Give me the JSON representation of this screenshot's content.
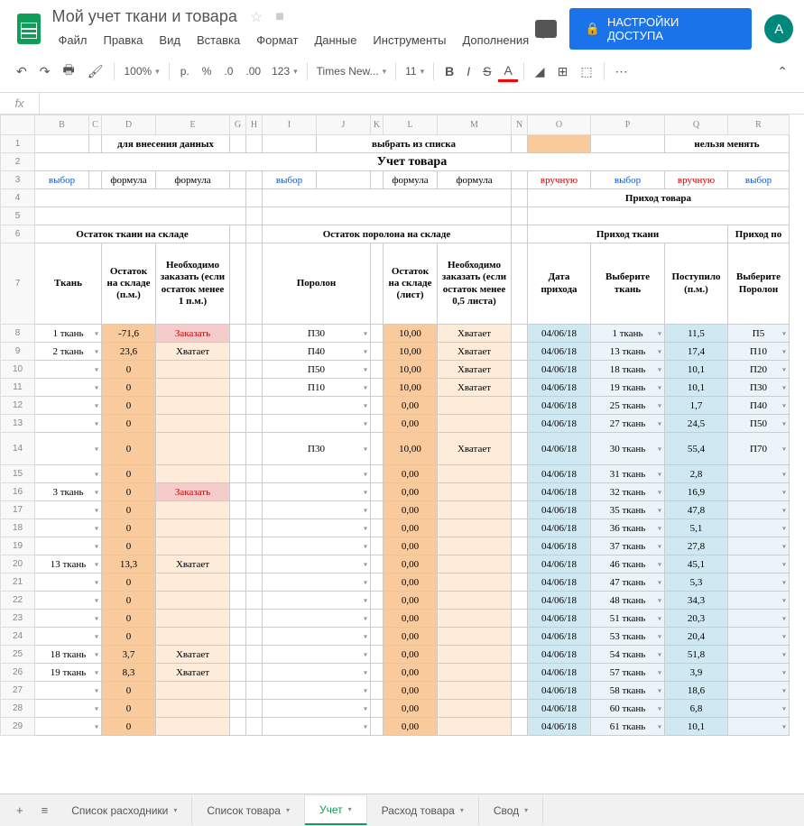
{
  "doc": {
    "title": "Мой учет ткани и товара",
    "avatar": "A"
  },
  "menus": [
    "Файл",
    "Правка",
    "Вид",
    "Вставка",
    "Формат",
    "Данные",
    "Инструменты",
    "Дополнения"
  ],
  "share": "НАСТРОЙКИ ДОСТУПА",
  "toolbar": {
    "zoom": "100%",
    "cur": "р.",
    "pct": "%",
    "dec0": ".0",
    "dec00": ".00",
    "num": "123",
    "font": "Times New...",
    "size": "11"
  },
  "fx": "fx",
  "cols": [
    "",
    "B",
    "C",
    "D",
    "E",
    "G",
    "H",
    "I",
    "J",
    "K",
    "L",
    "M",
    "N",
    "O",
    "P",
    "Q",
    "R"
  ],
  "widths": [
    38,
    60,
    14,
    60,
    82,
    18,
    18,
    60,
    60,
    14,
    60,
    82,
    18,
    70,
    82,
    70,
    68
  ],
  "legend": {
    "a": "для внесения данных",
    "b": "выбрать из списка",
    "c": "нельзя менять"
  },
  "title": "Учет товара",
  "hdr3": {
    "sel": "выбор",
    "form": "формула",
    "man": "вручную"
  },
  "hdr4": {
    "prihod": "Приход товара"
  },
  "hdr6": {
    "a": "Остаток ткани на складе",
    "b": "Остаток поролона на складе",
    "c": "Приход ткани",
    "d": "Приход по"
  },
  "hdr7": {
    "tkan": "Ткань",
    "ost_pm": "Остаток на складе (п.м.)",
    "ord_pm": "Необходимо заказать (если остаток менее 1 п.м.)",
    "por": "Поролон",
    "ost_l": "Остаток на складе (лист)",
    "ord_l": "Необходимо заказать (если остаток менее 0,5 листа)",
    "date": "Дата прихода",
    "seltk": "Выберите ткань",
    "post": "Поступило (п.м.)",
    "selpor": "Выберите Поролон"
  },
  "rows": [
    {
      "n": "8",
      "tk": "1 ткань",
      "ost": "-71,6",
      "ord": "Заказать",
      "por": "П30",
      "pol": "10,00",
      "pord": "Хватает",
      "dt": "04/06/18",
      "st": "1 ткань",
      "pm": "11,5",
      "sp": "П5"
    },
    {
      "n": "9",
      "tk": "2 ткань",
      "ost": "23,6",
      "ord": "Хватает",
      "por": "П40",
      "pol": "10,00",
      "pord": "Хватает",
      "dt": "04/06/18",
      "st": "13 ткань",
      "pm": "17,4",
      "sp": "П10"
    },
    {
      "n": "10",
      "tk": "",
      "ost": "0",
      "ord": "",
      "por": "П50",
      "pol": "10,00",
      "pord": "Хватает",
      "dt": "04/06/18",
      "st": "18 ткань",
      "pm": "10,1",
      "sp": "П20"
    },
    {
      "n": "11",
      "tk": "",
      "ost": "0",
      "ord": "",
      "por": "П10",
      "pol": "10,00",
      "pord": "Хватает",
      "dt": "04/06/18",
      "st": "19 ткань",
      "pm": "10,1",
      "sp": "П30"
    },
    {
      "n": "12",
      "tk": "",
      "ost": "0",
      "ord": "",
      "por": "",
      "pol": "0,00",
      "pord": "",
      "dt": "04/06/18",
      "st": "25 ткань",
      "pm": "1,7",
      "sp": "П40"
    },
    {
      "n": "13",
      "tk": "",
      "ost": "0",
      "ord": "",
      "por": "",
      "pol": "0,00",
      "pord": "",
      "dt": "04/06/18",
      "st": "27 ткань",
      "pm": "24,5",
      "sp": "П50"
    },
    {
      "n": "14",
      "tk": "",
      "ost": "0",
      "ord": "",
      "por": "П30",
      "pol": "10,00",
      "pord": "Хватает",
      "dt": "04/06/18",
      "st": "30 ткань",
      "pm": "55,4",
      "sp": "П70",
      "tall": true
    },
    {
      "n": "15",
      "tk": "",
      "ost": "0",
      "ord": "",
      "por": "",
      "pol": "0,00",
      "pord": "",
      "dt": "04/06/18",
      "st": "31 ткань",
      "pm": "2,8",
      "sp": ""
    },
    {
      "n": "16",
      "tk": "3 ткань",
      "ost": "0",
      "ord": "Заказать",
      "por": "",
      "pol": "0,00",
      "pord": "",
      "dt": "04/06/18",
      "st": "32 ткань",
      "pm": "16,9",
      "sp": ""
    },
    {
      "n": "17",
      "tk": "",
      "ost": "0",
      "ord": "",
      "por": "",
      "pol": "0,00",
      "pord": "",
      "dt": "04/06/18",
      "st": "35 ткань",
      "pm": "47,8",
      "sp": ""
    },
    {
      "n": "18",
      "tk": "",
      "ost": "0",
      "ord": "",
      "por": "",
      "pol": "0,00",
      "pord": "",
      "dt": "04/06/18",
      "st": "36 ткань",
      "pm": "5,1",
      "sp": ""
    },
    {
      "n": "19",
      "tk": "",
      "ost": "0",
      "ord": "",
      "por": "",
      "pol": "0,00",
      "pord": "",
      "dt": "04/06/18",
      "st": "37 ткань",
      "pm": "27,8",
      "sp": ""
    },
    {
      "n": "20",
      "tk": "13 ткань",
      "ost": "13,3",
      "ord": "Хватает",
      "por": "",
      "pol": "0,00",
      "pord": "",
      "dt": "04/06/18",
      "st": "46 ткань",
      "pm": "45,1",
      "sp": ""
    },
    {
      "n": "21",
      "tk": "",
      "ost": "0",
      "ord": "",
      "por": "",
      "pol": "0,00",
      "pord": "",
      "dt": "04/06/18",
      "st": "47 ткань",
      "pm": "5,3",
      "sp": ""
    },
    {
      "n": "22",
      "tk": "",
      "ost": "0",
      "ord": "",
      "por": "",
      "pol": "0,00",
      "pord": "",
      "dt": "04/06/18",
      "st": "48 ткань",
      "pm": "34,3",
      "sp": ""
    },
    {
      "n": "23",
      "tk": "",
      "ost": "0",
      "ord": "",
      "por": "",
      "pol": "0,00",
      "pord": "",
      "dt": "04/06/18",
      "st": "51 ткань",
      "pm": "20,3",
      "sp": ""
    },
    {
      "n": "24",
      "tk": "",
      "ost": "0",
      "ord": "",
      "por": "",
      "pol": "0,00",
      "pord": "",
      "dt": "04/06/18",
      "st": "53 ткань",
      "pm": "20,4",
      "sp": ""
    },
    {
      "n": "25",
      "tk": "18 ткань",
      "ost": "3,7",
      "ord": "Хватает",
      "por": "",
      "pol": "0,00",
      "pord": "",
      "dt": "04/06/18",
      "st": "54 ткань",
      "pm": "51,8",
      "sp": ""
    },
    {
      "n": "26",
      "tk": "19 ткань",
      "ost": "8,3",
      "ord": "Хватает",
      "por": "",
      "pol": "0,00",
      "pord": "",
      "dt": "04/06/18",
      "st": "57 ткань",
      "pm": "3,9",
      "sp": ""
    },
    {
      "n": "27",
      "tk": "",
      "ost": "0",
      "ord": "",
      "por": "",
      "pol": "0,00",
      "pord": "",
      "dt": "04/06/18",
      "st": "58 ткань",
      "pm": "18,6",
      "sp": ""
    },
    {
      "n": "28",
      "tk": "",
      "ost": "0",
      "ord": "",
      "por": "",
      "pol": "0,00",
      "pord": "",
      "dt": "04/06/18",
      "st": "60 ткань",
      "pm": "6,8",
      "sp": ""
    },
    {
      "n": "29",
      "tk": "",
      "ost": "0",
      "ord": "",
      "por": "",
      "pol": "0,00",
      "pord": "",
      "dt": "04/06/18",
      "st": "61 ткань",
      "pm": "10,1",
      "sp": ""
    }
  ],
  "tabs": [
    "Список расходники",
    "Список товара",
    "Учет",
    "Расход товара",
    "Свод"
  ],
  "active_tab": 2
}
